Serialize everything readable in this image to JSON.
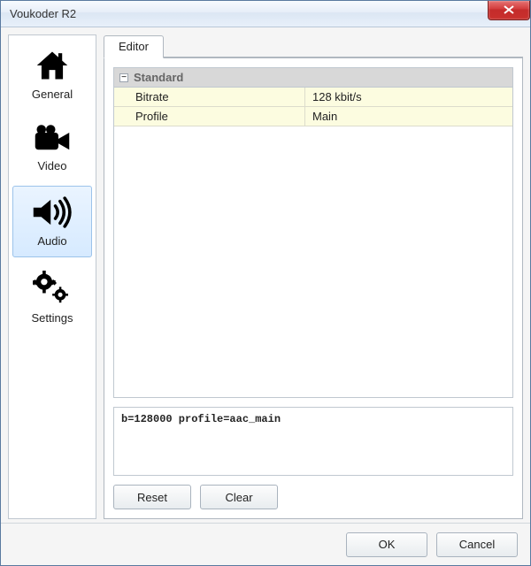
{
  "window": {
    "title": "Voukoder R2"
  },
  "sidebar": {
    "items": [
      {
        "id": "general",
        "label": "General"
      },
      {
        "id": "video",
        "label": "Video"
      },
      {
        "id": "audio",
        "label": "Audio"
      },
      {
        "id": "settings",
        "label": "Settings"
      }
    ],
    "selected": "audio"
  },
  "tabs": {
    "active": "editor",
    "editor_label": "Editor"
  },
  "property_grid": {
    "group_label": "Standard",
    "rows": [
      {
        "name": "Bitrate",
        "value": "128 kbit/s"
      },
      {
        "name": "Profile",
        "value": "Main"
      }
    ]
  },
  "param_string": "b=128000 profile=aac_main",
  "buttons": {
    "reset": "Reset",
    "clear": "Clear",
    "ok": "OK",
    "cancel": "Cancel"
  }
}
